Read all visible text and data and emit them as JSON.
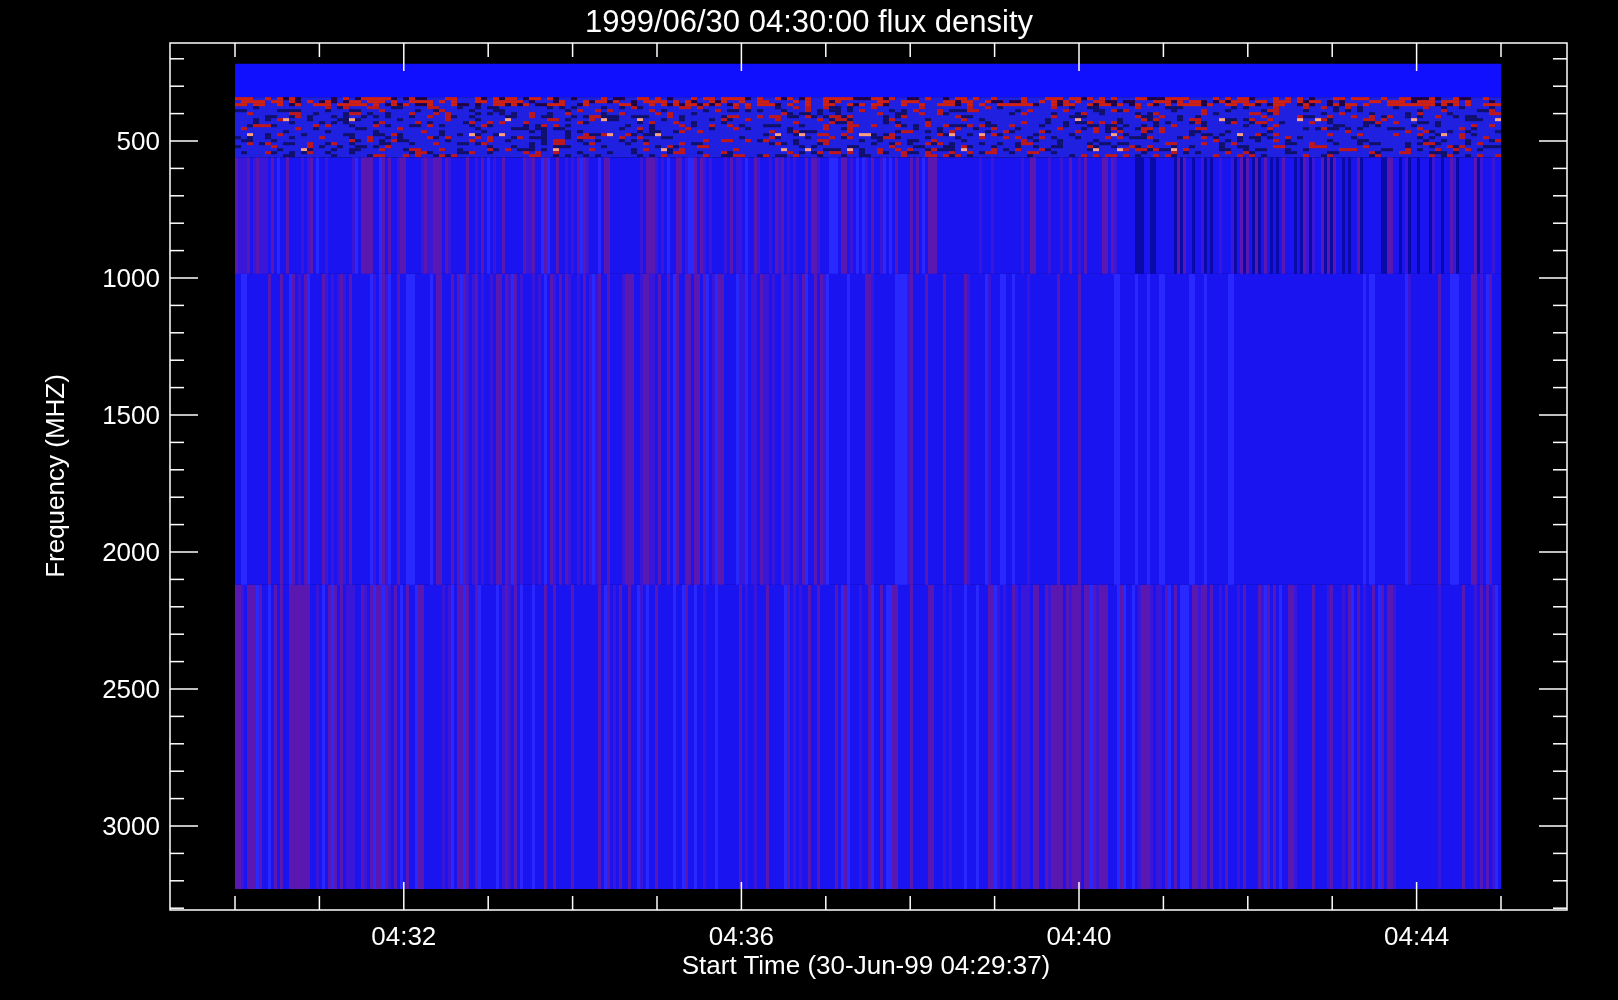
{
  "title": "1999/06/30 04:30:00 flux density",
  "y_axis": {
    "label": "Frequency (MHZ)",
    "ticks": [
      "500",
      "1000",
      "1500",
      "2000",
      "2500",
      "3000"
    ]
  },
  "x_axis": {
    "label": "Start Time (30-Jun-99 04:29:37)",
    "ticks": [
      "04:32",
      "04:36",
      "04:40",
      "04:44"
    ]
  }
}
